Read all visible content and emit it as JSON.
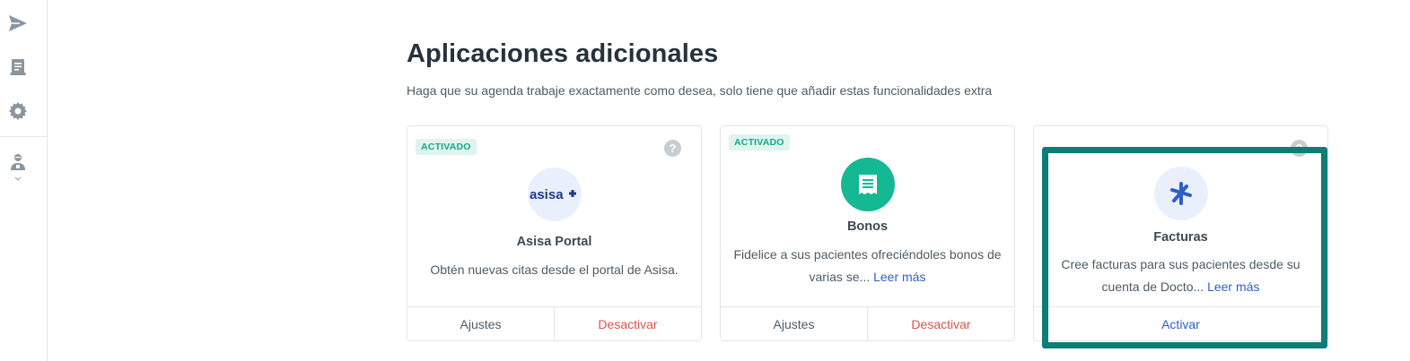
{
  "sidebar": {
    "icons": [
      "send-icon",
      "document-icon",
      "gear-icon",
      "user-icon",
      "chevron-down-icon"
    ]
  },
  "page": {
    "title": "Aplicaciones adicionales",
    "subtitle": "Haga que su agenda trabaje exactamente como desea, solo tiene que añadir estas funcionalidades extra"
  },
  "cards": [
    {
      "badge": "ACTIVADO",
      "logo_text": "asisa",
      "title": "Asisa Portal",
      "description": "Obtén nuevas citas desde el portal de Asisa.",
      "settings_label": "Ajustes",
      "deactivate_label": "Desactivar"
    },
    {
      "badge": "ACTIVADO",
      "title": "Bonos",
      "description": "Fidelice a sus pacientes ofreciéndoles bonos de varias se...",
      "read_more": "Leer más",
      "settings_label": "Ajustes",
      "deactivate_label": "Desactivar"
    },
    {
      "title": "Facturas",
      "description": "Cree facturas para sus pacientes desde su cuenta de Docto...",
      "read_more": "Leer más",
      "activate_label": "Activar"
    }
  ],
  "help_glyph": "?",
  "colors": {
    "accent_green": "#14b893",
    "badge_text": "#17a884",
    "link_blue": "#2e5fc7",
    "danger_red": "#d9534f",
    "highlight": "#0f7d77"
  }
}
